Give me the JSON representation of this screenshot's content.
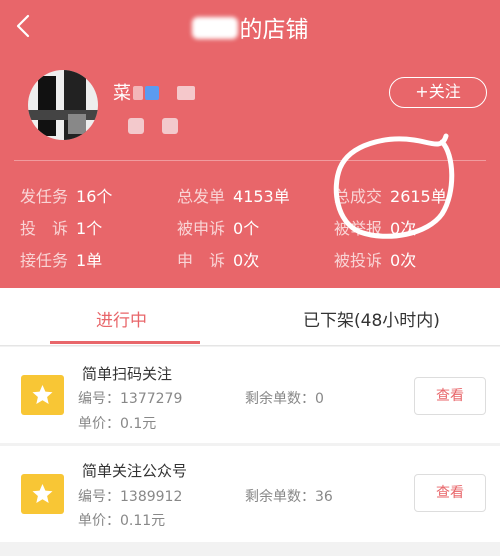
{
  "header": {
    "title": "的店铺",
    "username": "菜",
    "follow_label": "+关注",
    "colors": {
      "primary": "#e8666a",
      "star_icon_bg": "#f8c635"
    }
  },
  "stats": [
    {
      "label": "发任务",
      "value": "16个"
    },
    {
      "label": "总发单",
      "value": "4153单"
    },
    {
      "label": "总成交",
      "value": "2615单"
    },
    {
      "label": "投　诉",
      "value": "1个"
    },
    {
      "label": "被申诉",
      "value": "0个"
    },
    {
      "label": "被举报",
      "value": "0次"
    },
    {
      "label": "接任务",
      "value": "1单"
    },
    {
      "label": "申　诉",
      "value": "0次"
    },
    {
      "label": "被投诉",
      "value": "0次"
    }
  ],
  "tabs": [
    {
      "label": "进行中"
    },
    {
      "label": "已下架(48小时内)"
    }
  ],
  "tasks": [
    {
      "title": "简单扫码关注",
      "number_label": "编号：",
      "number": "1377279",
      "remain_label": "剩余单数：",
      "remain": "0",
      "price_label": "单价：",
      "price": "0.1元",
      "button": "查看",
      "icon": "star-icon"
    },
    {
      "title": "简单关注公众号",
      "number_label": "编号：",
      "number": "1389912",
      "remain_label": "剩余单数：",
      "remain": "36",
      "price_label": "单价：",
      "price": "0.11元",
      "button": "查看",
      "icon": "star-icon"
    }
  ]
}
